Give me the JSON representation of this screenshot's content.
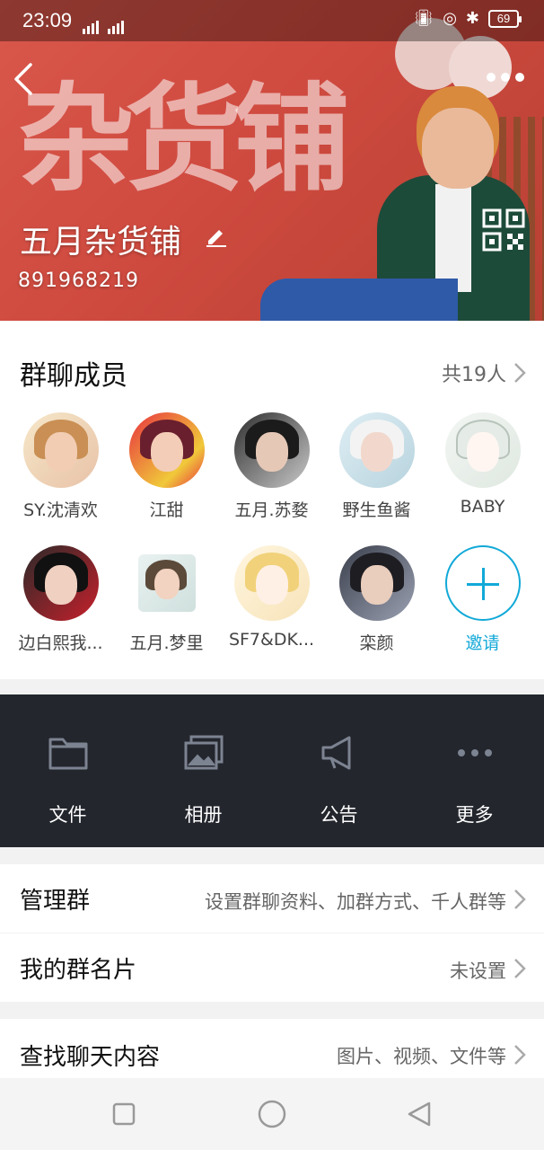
{
  "status_bar": {
    "time": "23:09",
    "network": "4G+ 2G",
    "battery": "69"
  },
  "header": {
    "group_name": "五月杂货铺",
    "group_id": "891968219",
    "banner_text": "杂货铺"
  },
  "members": {
    "title": "群聊成员",
    "count": "共19人",
    "list": [
      {
        "name": "SY.沈清欢"
      },
      {
        "name": "江甜"
      },
      {
        "name": "五月.苏婺"
      },
      {
        "name": "野生鱼酱"
      },
      {
        "name": "BABY"
      },
      {
        "name": "边白熙我..."
      },
      {
        "name": "五月.梦里"
      },
      {
        "name": "SF7&DK..."
      },
      {
        "name": "栾颜"
      }
    ],
    "invite_label": "邀请"
  },
  "tools": [
    {
      "label": "文件",
      "icon": "folder-icon"
    },
    {
      "label": "相册",
      "icon": "album-icon"
    },
    {
      "label": "公告",
      "icon": "announcement-icon"
    },
    {
      "label": "更多",
      "icon": "more-dots-icon"
    }
  ],
  "rows": {
    "manage": {
      "label": "管理群",
      "value": "设置群聊资料、加群方式、千人群等"
    },
    "card": {
      "label": "我的群名片",
      "value": "未设置"
    },
    "search": {
      "label": "查找聊天内容",
      "value": "图片、视频、文件等"
    }
  },
  "colors": {
    "accent": "#12a9d8",
    "banner": "#d9574b",
    "tools_bg": "#23262d"
  }
}
